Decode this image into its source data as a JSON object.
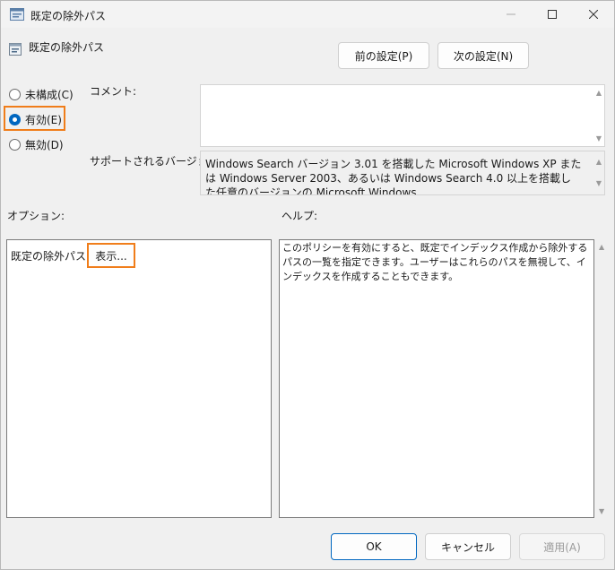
{
  "window": {
    "title": "既定の除外パス"
  },
  "policy": {
    "name": "既定の除外パス"
  },
  "nav": {
    "prev_label": "前の設定(P)",
    "next_label": "次の設定(N)"
  },
  "state": {
    "options": [
      {
        "label": "未構成(C)",
        "selected": false
      },
      {
        "label": "有効(E)",
        "selected": true
      },
      {
        "label": "無効(D)",
        "selected": false
      }
    ]
  },
  "comment": {
    "label": "コメント:",
    "value": ""
  },
  "supported": {
    "label": "サポートされるバージョン:",
    "text": "Windows Search バージョン 3.01 を搭載した Microsoft Windows XP または Windows Server 2003、あるいは Windows Search 4.0 以上を搭載した任意のバージョンの Microsoft Windows"
  },
  "options_section": {
    "label": "オプション:",
    "item_label": "既定の除外パス",
    "show_button": "表示..."
  },
  "help_section": {
    "label": "ヘルプ:",
    "text": "このポリシーを有効にすると、既定でインデックス作成から除外するパスの一覧を指定できます。ユーザーはこれらのパスを無視して、インデックスを作成することもできます。"
  },
  "footer": {
    "ok_label": "OK",
    "cancel_label": "キャンセル",
    "apply_label": "適用(A)"
  }
}
